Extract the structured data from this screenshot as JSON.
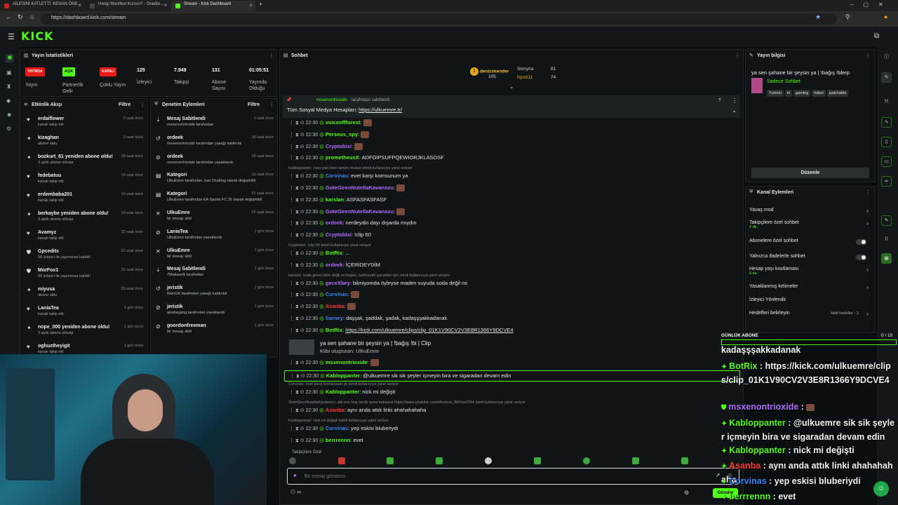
{
  "browser": {
    "tabs": [
      {
        "label": "AİLESİNİ KATLETTİ: KENAN ÖNE..."
      },
      {
        "label": "Hangi Manifest Kızısın? - Onedio..."
      },
      {
        "label": "Stream - Kick Dashboard"
      }
    ],
    "url": "https://dashboard.kick.com/stream"
  },
  "brand": {
    "logo": "KICK",
    "accent": "#53fc18"
  },
  "stats": {
    "title": "Yayın İstatistikleri",
    "items": [
      {
        "value": "YAYINDA",
        "label": "Yayın",
        "color": "#e91916"
      },
      {
        "value": "AÇIK",
        "label": "Partnerlik Gelir",
        "color": "#53fc18"
      },
      {
        "value": "KAPALI",
        "label": "Çoklu Yayın",
        "color": "#e91916"
      },
      {
        "value": "125",
        "label": "İzleyici"
      },
      {
        "value": "7.949",
        "label": "Takipçi"
      },
      {
        "value": "131",
        "label": "Abone Sayısı"
      },
      {
        "value": "01:05:51",
        "label": "Yayında Olduğu"
      }
    ]
  },
  "activity": {
    "title": "Etkinlik Akışı",
    "filter": "Filtre",
    "items": [
      {
        "name": "erdaiflower",
        "sub": "kanalı takip etti",
        "time": "2 saat önce",
        "icon": "heart-icon"
      },
      {
        "name": "kizaghan",
        "sub": "abone oldu",
        "time": "2 saat önce",
        "icon": "star-icon"
      },
      {
        "name": "bozkurt_61 yeniden abone oldu!",
        "sub": "3 aylık abone oldular",
        "time": "18 saat önce",
        "icon": "star-icon"
      },
      {
        "name": "fedebatuu",
        "sub": "kanalı takip etti",
        "time": "19 saat önce",
        "icon": "heart-icon"
      },
      {
        "name": "erdembaba201",
        "sub": "kanalı takip etti",
        "time": "19 saat önce",
        "icon": "heart-icon"
      },
      {
        "name": "berkaybe yeniden abone oldu!",
        "sub": "3 aylık abone oldular",
        "time": "19 saat önce",
        "icon": "star-icon"
      },
      {
        "name": "Avamyz",
        "sub": "kanalı takip etti",
        "time": "22 saat önce",
        "icon": "heart-icon"
      },
      {
        "name": "Gpcedits",
        "sub": "58 izleyici ile yayınınıza katıldı!",
        "time": "22 saat önce",
        "icon": "raid-icon"
      },
      {
        "name": "MorFox1",
        "sub": "60 izleyici ile yayınınıza katıldı!",
        "time": "22 saat önce",
        "icon": "raid-icon"
      },
      {
        "name": "miyusa",
        "sub": "abone oldu",
        "time": "23 saat önce",
        "icon": "star-icon"
      },
      {
        "name": "LaniaTea",
        "sub": "kanalı takip etti",
        "time": "1 gün önce",
        "icon": "heart-icon"
      },
      {
        "name": "nope_000 yeniden abone oldu!",
        "sub": "3 aylık abone oldular",
        "time": "1 gün önce",
        "icon": "star-icon"
      },
      {
        "name": "oghuztheyigit",
        "sub": "kanalı takip etti",
        "time": "1 gün önce",
        "icon": "heart-icon"
      }
    ]
  },
  "moderation": {
    "title": "Denetim Eylemleri",
    "filter": "Filtre",
    "items": [
      {
        "name": "Mesaj Sabitlendi",
        "sub": "msxenontrioxide tarafından",
        "time": "1 saat önce",
        "icon": "pin-icon"
      },
      {
        "name": "ordeek",
        "sub": "msxenontrioxide tarafından yasağı kaldırıldı",
        "time": "18 saat önce",
        "icon": "unban-icon"
      },
      {
        "name": "ordeek",
        "sub": "msxenontrioxide tarafından yasaklandı",
        "time": "18 saat önce",
        "icon": "ban-icon"
      },
      {
        "name": "Kategori",
        "sub": "UlkuEmre tarafından Just Chatting olarak değiştirildi",
        "time": "19 saat önce",
        "icon": "category-icon"
      },
      {
        "name": "Kategori",
        "sub": "UlkuEmre tarafından EA Sports FC 25 olarak değiştirildi",
        "time": "21 saat önce",
        "icon": "category-icon"
      },
      {
        "name": "UlkuEmre",
        "sub": "bir mesajı sildi",
        "time": "23 saat önce",
        "icon": "trash-icon"
      },
      {
        "name": "LaniaTea",
        "sub": "UlkuEmre tarafından yasaklandı",
        "time": "1 gün önce",
        "icon": "ban-icon"
      },
      {
        "name": "UlkuEmre",
        "sub": "bir mesajı sildi",
        "time": "1 gün önce",
        "icon": "trash-icon"
      },
      {
        "name": "Mesaj Sabitlendi",
        "sub": "7Makavelli tarafından",
        "time": "1 gün önce",
        "icon": "pin-icon"
      },
      {
        "name": "jeristik",
        "sub": "ReinGK tarafından yasağı kaldırıldı",
        "time": "1 gün önce",
        "icon": "unban-icon"
      },
      {
        "name": "jeristik",
        "sub": "alsokegang tarafından yasaklandı",
        "time": "1 gün önce",
        "icon": "ban-icon"
      },
      {
        "name": "goordonfreeman",
        "sub": "bir mesajı sildi",
        "time": "1 gün önce",
        "icon": "ban-icon"
      }
    ]
  },
  "chat": {
    "title": "Sohbet",
    "top": [
      {
        "name": "denizskender",
        "amount": "105"
      },
      {
        "name": "Slonyha",
        "amount": "81"
      },
      {
        "name": "Njord11",
        "amount": "74"
      }
    ],
    "pinned": {
      "by": "msxenontrioxide",
      "by_suffix": "tarafından sabitlendi",
      "text": "Tüm Sosyal Medya Hesapları:",
      "link": "https://ulkuemre.tr/"
    },
    "lines": [
      {
        "time": "22:30",
        "user": "voiceoffforest",
        "color": "#53fc18",
        "text": ""
      },
      {
        "time": "22:30",
        "user": "Perseus_spy",
        "color": "#53fc18",
        "text": ""
      },
      {
        "time": "22:30",
        "user": "Cryptobixi",
        "color": "#b06cff",
        "text": ""
      },
      {
        "time": "22:30",
        "user": "prometheusX",
        "color": "#53fc18",
        "text": "ADFOIPSUFPQEWIORJKLASDSF"
      },
      {
        "reply": "Kabloppanter: nası yani beni tanıyo musun isimli kullanıcıya yanıt veriyor"
      },
      {
        "time": "22:30",
        "user": "Corvinas",
        "color": "#3b82f6",
        "text": "evet karşı komsunum ya"
      },
      {
        "time": "22:30",
        "user": "GoteGirenNutellaKavanozu",
        "color": "#b06cff",
        "text": ""
      },
      {
        "time": "22:30",
        "user": "karslan",
        "color": "#53fc18",
        "text": "ASFASFASFASF"
      },
      {
        "time": "22:30",
        "user": "GoteGirenNutellaKavanozu",
        "color": "#b06cff",
        "text": ""
      },
      {
        "time": "22:30",
        "user": "ordeek",
        "color": "#b06cff",
        "text": "nerdeydin dayı dışarda mıydın"
      },
      {
        "time": "22:30",
        "user": "Cryptobixi",
        "color": "#b06cff",
        "text": "!clip 60"
      },
      {
        "reply": "Cryptobixi: !clip 60 isimli kullanıcıya yanıt veriyor"
      },
      {
        "time": "22:30",
        "user": "BotRix",
        "color": "#53fc18",
        "text": "..."
      },
      {
        "time": "22:30",
        "user": "ordeek",
        "color": "#b06cff",
        "text": "İÇERİDEYDİM"
      },
      {
        "reply": "karslan: soda genel islim değil mi hojam, karbonatlı içecekler için isimli kullanıcıya yanıt veriyor"
      },
      {
        "time": "22:30",
        "user": "geceXbey",
        "color": "#b06cff",
        "text": "bilmiyomda öyleyse maden suyuda soda değil mi"
      },
      {
        "time": "22:30",
        "user": "Corvinas",
        "color": "#3b82f6",
        "text": ""
      },
      {
        "time": "22:30",
        "user": "Asanba",
        "color": "#ff3b3b",
        "text": ""
      },
      {
        "time": "22:30",
        "user": "Sarney",
        "color": "#3b82f6",
        "text": "daşşak, şaddak, şadak, kadaşşşakkadanak"
      },
      {
        "time": "22:30",
        "user": "BotRix",
        "color": "#53fc18",
        "text": "https://kick.com/ulkuemre/clips/clip_01K1V90CV2V3E8R1366Y9DCVE4"
      },
      {
        "clip_title": "ya sen şahane bir şeysin ya | !bağış !bi | Clip",
        "clip_sub": "Klibi oluşturan: UlkuEmre"
      },
      {
        "time": "22:30",
        "user": "msxenontrioxide",
        "color": "#53fc18",
        "text": ""
      },
      {
        "time": "22:30",
        "user": "Kabloppanter",
        "color": "#53fc18",
        "text": "@ulkuemre sik sik şeyler içmeyin bira ve sigaradan devam edin",
        "highlight": true
      },
      {
        "reply": "Corvinas: evet karşı komsunum ya isimli kullanıcıya yanıt veriyor"
      },
      {
        "time": "22:30",
        "user": "Kabloppanter",
        "color": "#53fc18",
        "text": "nick mi değişti"
      },
      {
        "reply": "GoteGirenNutellaKavanozu: abi onu boş verde şuna baksana https://www.youtube.com/shorts/a_8bFew2264 isimli kullanıcıya yanıt veriyor"
      },
      {
        "time": "22:30",
        "user": "Asanba",
        "color": "#ff3b3b",
        "text": "aynı anda attık linki ahahahahaha"
      },
      {
        "reply": "Kabloppanter: nick mi değişti isimli kullanıcıya yanıt veriyor"
      },
      {
        "time": "22:30",
        "user": "Corvinas",
        "color": "#3b82f6",
        "text": "yep eskisi bluberiydi"
      },
      {
        "time": "22:30",
        "user": "berrrennn",
        "color": "#53fc18",
        "text": "evet"
      }
    ],
    "followers_only": "Takipçilere Özel",
    "input_placeholder": "Bir mesaj gönderin",
    "send_label": "Gönder"
  },
  "stream_info": {
    "title": "Yayın bilgisi",
    "stream_title": "ya sen şahane bir şeysin ya | !bağış !blerp",
    "category": "Sadece Sohbet",
    "tags": [
      "Turkish",
      "irl",
      "gaming",
      "futbol",
      "justchattin"
    ],
    "edit": "Düzenle"
  },
  "channel_actions": {
    "title": "Kanal Eylemleri",
    "items": [
      {
        "label": "Yavaş mod",
        "sub": "",
        "control": "chevron"
      },
      {
        "label": "Takipçilere özel sohbet",
        "sub": "2 dk.",
        "control": "chevron"
      },
      {
        "label": "Abonelere özel sohbet",
        "sub": "",
        "control": "toggle"
      },
      {
        "label": "Yalnızca ifadelerle sohbet",
        "sub": "",
        "control": "toggle"
      },
      {
        "label": "Hesap yaşı kısıtlaması",
        "sub": "5 sa.",
        "control": "chevron"
      },
      {
        "label": "Yasaklanmış kelimeler",
        "sub": "",
        "control": "chevron"
      },
      {
        "label": "İzleyici Yönlendir",
        "sub": "",
        "control": "none"
      },
      {
        "label": "Hedefleri belirleyin",
        "sub": "Aktif hedefler - 2",
        "control": "chevron"
      }
    ]
  },
  "overlay": {
    "goal_label": "GÜNLÜK ABONE",
    "goal_value": "0 / 10",
    "goal_progress": 0,
    "lines": [
      {
        "user": "",
        "text": "kadaşşşakkadanak"
      },
      {
        "user": "BotRix",
        "text": "https://kick.com/ulkuemre/clips/clip_01K1V90CV2V3E8R1366Y9DCVE4"
      },
      {
        "user": "msxenontrioxide",
        "text": ""
      },
      {
        "user": "Kabloppanter",
        "text": "@ulkuemre sik sik şeyler içmeyin bira ve sigaradan devam edin"
      },
      {
        "user": "Kabloppanter",
        "text": "nick mi değişti"
      },
      {
        "user": "Asanba",
        "text": "aynı anda attık linki ahahahahaha"
      },
      {
        "user": "Corvinas",
        "text": "yep eskisi bluberiydi"
      },
      {
        "user": "berrrennn",
        "text": "evet"
      }
    ]
  }
}
